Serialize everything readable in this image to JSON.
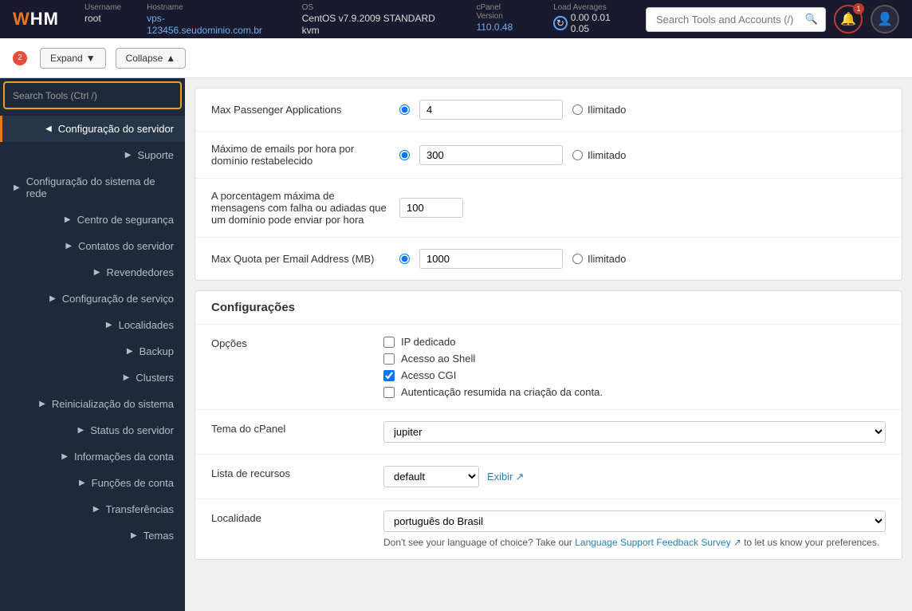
{
  "topbar": {
    "logo_text": "WHM",
    "username_label": "Username",
    "username_value": "root",
    "hostname_label": "Hostname",
    "hostname_value": "vps-123456.seudominio.com.br",
    "os_label": "OS",
    "os_value": "CentOS v7.9.2009 STANDARD kvm",
    "cpanel_label": "cPanel Version",
    "cpanel_value": "110.0.48",
    "load_label": "Load Averages",
    "load_values": "0.00  0.01  0.05",
    "bell_badge": "1",
    "search_placeholder": "Search Tools and Accounts (/)"
  },
  "secondary": {
    "expand_label": "Expand",
    "collapse_label": "Collapse",
    "badge_num": "2",
    "search_placeholder": "Search Tools (Ctrl /)"
  },
  "sidebar": {
    "items": [
      {
        "id": "configuracao-servidor",
        "label": "Configuração do servidor",
        "expanded": true
      },
      {
        "id": "suporte",
        "label": "Suporte",
        "expanded": false
      },
      {
        "id": "configuracao-rede",
        "label": "Configuração do sistema de rede",
        "expanded": false
      },
      {
        "id": "centro-seguranca",
        "label": "Centro de segurança",
        "expanded": false
      },
      {
        "id": "contatos-servidor",
        "label": "Contatos do servidor",
        "expanded": false
      },
      {
        "id": "revendedores",
        "label": "Revendedores",
        "expanded": false
      },
      {
        "id": "configuracao-servico",
        "label": "Configuração de serviço",
        "expanded": false
      },
      {
        "id": "localidades",
        "label": "Localidades",
        "expanded": false
      },
      {
        "id": "backup",
        "label": "Backup",
        "expanded": false
      },
      {
        "id": "clusters",
        "label": "Clusters",
        "expanded": false
      },
      {
        "id": "reinicializacao",
        "label": "Reinicialização do sistema",
        "expanded": false
      },
      {
        "id": "status-servidor",
        "label": "Status do servidor",
        "expanded": false
      },
      {
        "id": "informacoes-conta",
        "label": "Informações da conta",
        "expanded": false
      },
      {
        "id": "funcoes-conta",
        "label": "Funções de conta",
        "expanded": false
      },
      {
        "id": "transferencias",
        "label": "Transferências",
        "expanded": false
      },
      {
        "id": "temas",
        "label": "Temas",
        "expanded": false
      }
    ]
  },
  "form": {
    "rows": [
      {
        "id": "max-passenger",
        "label": "Max Passenger Applications",
        "value": "4",
        "unlimited_label": "Ilimitado"
      },
      {
        "id": "max-emails",
        "label": "Máximo de emails por hora por domínio restabelecido",
        "value": "300",
        "unlimited_label": "Ilimitado"
      },
      {
        "id": "max-falha",
        "label": "A porcentagem máxima de mensagens com falha ou adiadas que um domínio pode enviar por hora",
        "value": "100"
      },
      {
        "id": "max-quota",
        "label": "Max Quota per Email Address (MB)",
        "value": "1000",
        "unlimited_label": "Ilimitado"
      }
    ]
  },
  "configuracoes": {
    "title": "Configurações",
    "opcoes_label": "Opções",
    "checkboxes": [
      {
        "id": "ip-dedicado",
        "label": "IP dedicado",
        "checked": false
      },
      {
        "id": "acesso-shell",
        "label": "Acesso ao Shell",
        "checked": false
      },
      {
        "id": "acesso-cgi",
        "label": "Acesso CGI",
        "checked": true
      },
      {
        "id": "autenticacao",
        "label": "Autenticação resumida na criação da conta.",
        "checked": false
      }
    ],
    "tema_label": "Tema do cPanel",
    "tema_value": "jupiter",
    "tema_options": [
      "jupiter"
    ],
    "recursos_label": "Lista de recursos",
    "recursos_value": "default",
    "recursos_options": [
      "default"
    ],
    "recursos_exibir": "Exibir",
    "localidade_label": "Localidade",
    "localidade_value": "português do Brasil",
    "localidade_options": [
      "português do Brasil"
    ],
    "localidade_note": "Don't see your language of choice? Take our Language Support Feedback Survey",
    "localidade_note2": "to let us know your preferences."
  }
}
